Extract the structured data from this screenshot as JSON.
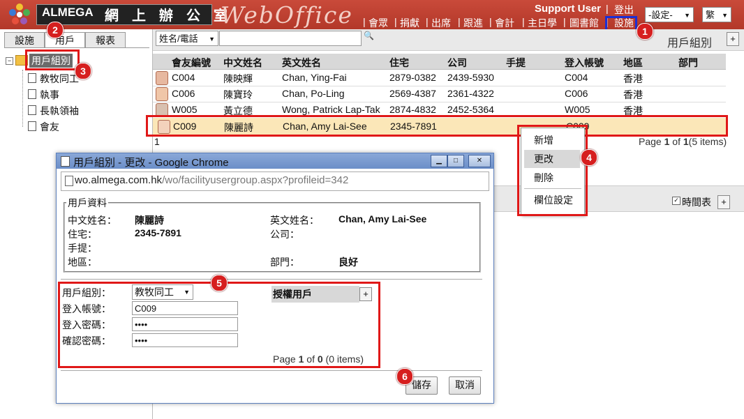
{
  "header": {
    "brand_name": "ALMEGA",
    "brand_cn": "網 上 辦 公 室",
    "product": "WebOffice",
    "user": "Support User",
    "logout": "登出",
    "nav": [
      "會眾",
      "捐獻",
      "出席",
      "跟進",
      "會計",
      "主日學",
      "圖書館",
      "設施"
    ],
    "settings_select": "-設定-",
    "lang_select": "繁",
    "separator": "|"
  },
  "left_tabs": [
    "設施",
    "用戶",
    "報表"
  ],
  "tree": {
    "root": "用戶組別",
    "children": [
      "教牧同工",
      "執事",
      "長執領袖",
      "會友"
    ]
  },
  "toolbar": {
    "filter_select": "姓名/電話",
    "search_placeholder": "",
    "search_icon": "magnifier-icon",
    "grid_title": "用戶組別",
    "add": "+"
  },
  "grid": {
    "columns": [
      "會友編號",
      "中文姓名",
      "英文姓名",
      "住宅",
      "公司",
      "手提",
      "登入帳號",
      "地區",
      "部門"
    ],
    "rows": [
      {
        "id": "C004",
        "cn": "陳映輝",
        "en": "Chan, Ying-Fai",
        "home": "2879-0382",
        "office": "2439-5930",
        "mobile": "",
        "login": "C004",
        "region": "香港",
        "dept": ""
      },
      {
        "id": "C006",
        "cn": "陳寶玲",
        "en": "Chan, Po-Ling",
        "home": "2569-4387",
        "office": "2361-4322",
        "mobile": "",
        "login": "C006",
        "region": "香港",
        "dept": ""
      },
      {
        "id": "W005",
        "cn": "黃立德",
        "en": "Wong, Patrick Lap-Tak",
        "home": "2874-4832",
        "office": "2452-5364",
        "mobile": "",
        "login": "W005",
        "region": "香港",
        "dept": ""
      },
      {
        "id": "C009",
        "cn": "陳麗詩",
        "en": "Chan, Amy Lai-See",
        "home": "2345-7891",
        "office": "",
        "mobile": "",
        "login": "C009",
        "region": "",
        "dept": ""
      }
    ],
    "page_number": "1",
    "pager_prefix": "Page",
    "pager_current": "1",
    "pager_of": "of",
    "pager_total": "1",
    "pager_items": "(5 items)"
  },
  "context_menu": [
    "新增",
    "更改",
    "刪除",
    "欄位設定"
  ],
  "lower_bar": {
    "checkbox_label": "時間表",
    "add": "+"
  },
  "dialog": {
    "title": "用戶組別 - 更改 - Google Chrome",
    "url_host": "wo.almega.com.hk",
    "url_path": "/wo/facilityusergroup.aspx?profileid=342",
    "legend": "用戶資料",
    "labels": {
      "cn_name": "中文姓名：",
      "home": "住宅：",
      "mobile": "手提：",
      "region": "地區：",
      "en_name": "英文姓名：",
      "office": "公司：",
      "dept": "部門："
    },
    "values": {
      "cn_name": "陳麗詩",
      "home": "2345-7891",
      "en_name": "Chan, Amy Lai-See",
      "dept": "良好"
    },
    "form": {
      "group_label": "用戶組別：",
      "group_value": "教牧同工",
      "login_label": "登入帳號：",
      "login_value": "C009",
      "pwd_label": "登入密碼：",
      "pwd_value": "••••",
      "confirm_label": "確認密碼：",
      "confirm_value": "••••"
    },
    "auth_title": "授權用戶",
    "auth_add": "+",
    "auth_pager_prefix": "Page",
    "auth_pager_current": "1",
    "auth_pager_of": "of",
    "auth_pager_total": "0",
    "auth_pager_items": "(0 items)",
    "save": "儲存",
    "cancel": "取消"
  },
  "callouts": [
    "1",
    "2",
    "3",
    "4",
    "5",
    "6"
  ],
  "colors": {
    "header_red": "#b83b2c",
    "highlight": "#fbe7b8",
    "callout": "#d61f1f",
    "callout_blue": "#1a2fd6"
  }
}
